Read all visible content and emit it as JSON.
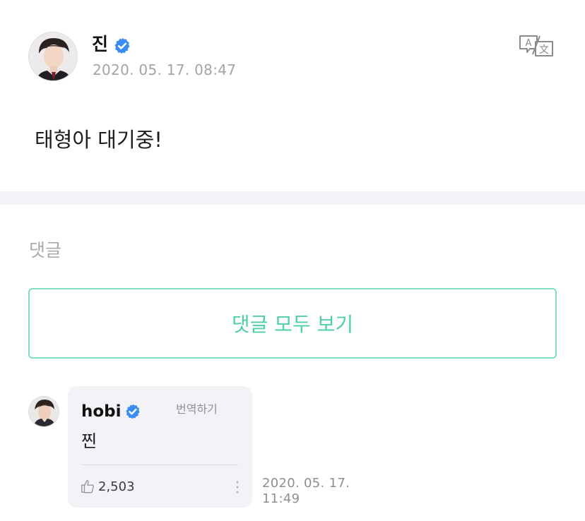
{
  "post": {
    "author": "진",
    "timestamp": "2020. 05. 17. 08:47",
    "body": "태형아 대기중!",
    "translate_icon": "translate-icon"
  },
  "comments_section": {
    "heading": "댓글",
    "view_all_label": "댓글 모두 보기"
  },
  "comment": {
    "author": "hobi",
    "translate_label": "번역하기",
    "text": "찐",
    "likes": "2,503",
    "timestamp_date": "2020. 05. 17.",
    "timestamp_time": "11:49"
  },
  "colors": {
    "accent": "#4fcfa8",
    "verified": "#3b8ef0",
    "muted": "#a3a3a8",
    "bubble": "#f3f3f7"
  }
}
